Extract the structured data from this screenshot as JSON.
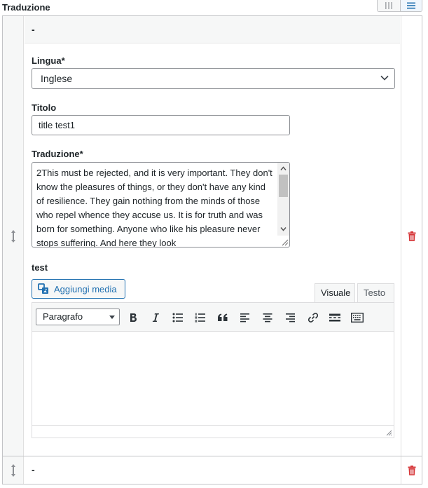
{
  "field": {
    "title": "Traduzione"
  },
  "rows": [
    {
      "header": "-",
      "lingua": {
        "label": "Lingua*",
        "value": "Inglese"
      },
      "titolo": {
        "label": "Titolo",
        "value": "title test1"
      },
      "traduzione": {
        "label": "Traduzione*",
        "value": "2This must be rejected, and it is very important. They don't know the pleasures of things, or they don't have any kind of resilience. They gain nothing from the minds of those who repel whence they accuse us. It is for truth and was born for something. Anyone who like his pleasure never stops suffering. And here they look"
      },
      "test": {
        "label": "test",
        "media_button": "Aggiungi media",
        "tabs": {
          "visual": "Visuale",
          "text": "Testo"
        },
        "format_select": "Paragrafo"
      }
    },
    {
      "header": "-"
    }
  ],
  "icons": {
    "drag": "drag-handle-icon",
    "delete": "trash-icon",
    "media": "add-media-icon"
  },
  "colors": {
    "accent": "#2271b1",
    "delete": "#d63638",
    "border": "#c3c4c7"
  }
}
